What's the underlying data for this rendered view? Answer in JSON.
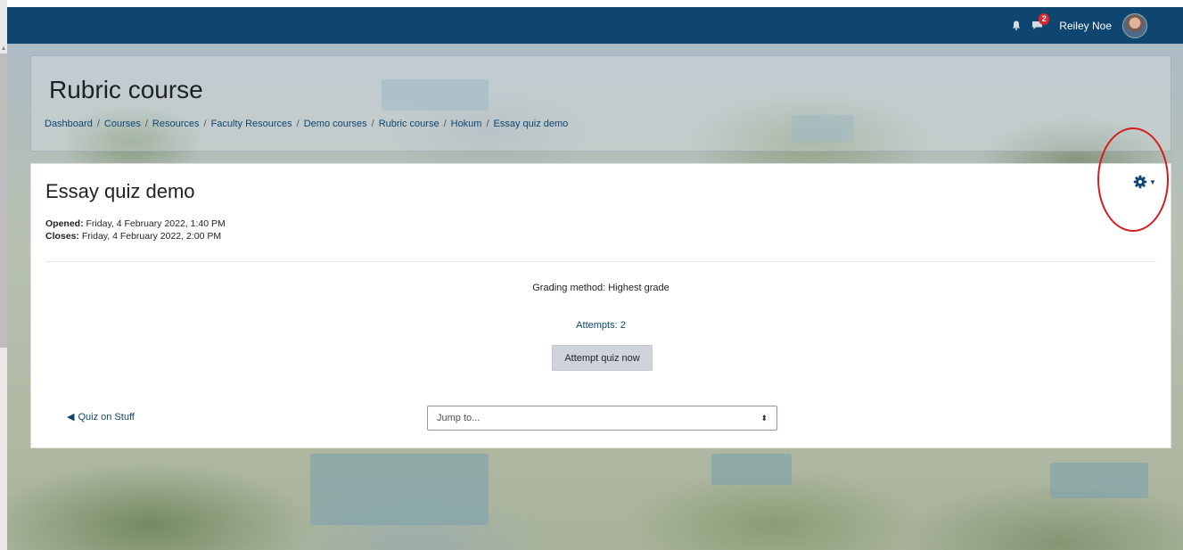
{
  "navbar": {
    "user_name": "Reiley Noe",
    "notification_icon": "bell-icon",
    "messages_icon": "chat-icon",
    "messages_badge": "2",
    "color": "#0f4670"
  },
  "header": {
    "course_title": "Rubric course",
    "breadcrumb": [
      "Dashboard",
      "Courses",
      "Resources",
      "Faculty Resources",
      "Demo courses",
      "Rubric course",
      "Hokum",
      "Essay quiz demo"
    ],
    "separator": "/"
  },
  "quiz": {
    "title": "Essay quiz demo",
    "opened_label": "Opened:",
    "opened_value": "Friday, 4 February 2022, 1:40 PM",
    "closes_label": "Closes:",
    "closes_value": "Friday, 4 February 2022, 2:00 PM",
    "grading_method": "Grading method: Highest grade",
    "attempts": "Attempts: 2",
    "attempt_button": "Attempt quiz now",
    "settings_icon": "gear-icon"
  },
  "footer_nav": {
    "prev_activity": "Quiz on Stuff",
    "jump_to": "Jump to..."
  },
  "colors": {
    "link": "#0f4670",
    "highlight_annotation": "#d61c1c"
  }
}
